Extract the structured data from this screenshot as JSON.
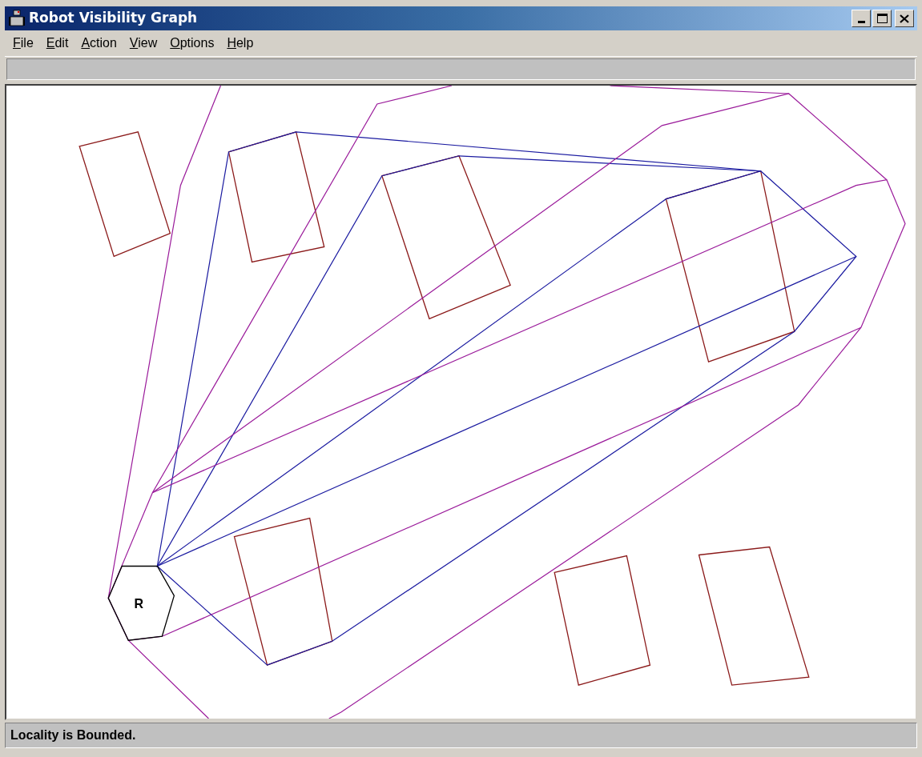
{
  "window": {
    "title": "Robot Visibility Graph"
  },
  "menu": [
    {
      "label": "File"
    },
    {
      "label": "Edit"
    },
    {
      "label": "Action"
    },
    {
      "label": "View"
    },
    {
      "label": "Options"
    },
    {
      "label": "Help"
    }
  ],
  "canvas": {
    "robot_label": "R"
  },
  "status_bar": {
    "text": "Locality is Bounded."
  }
}
